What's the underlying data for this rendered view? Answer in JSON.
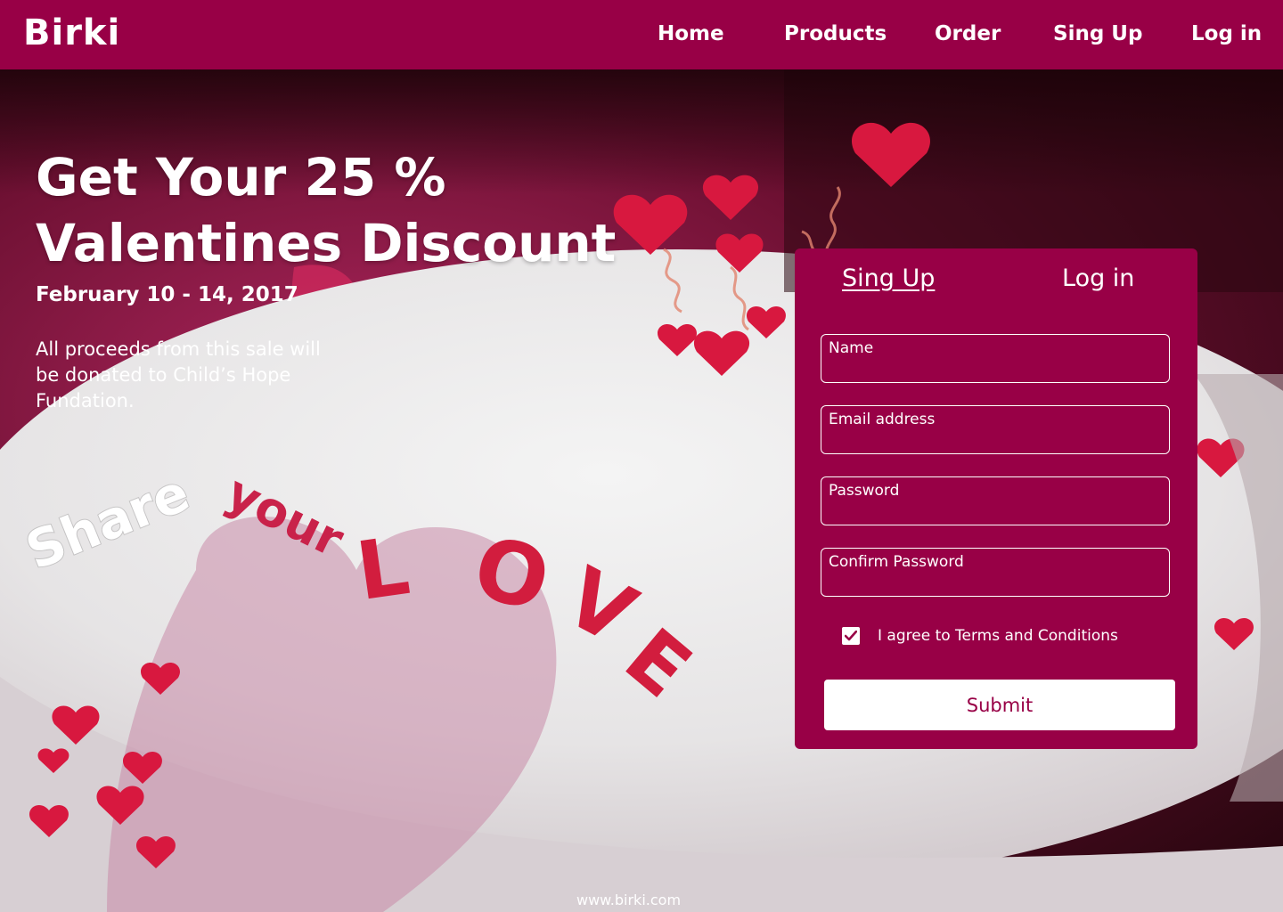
{
  "brand": "Birki",
  "nav": {
    "home": "Home",
    "products": "Products",
    "order": "Order",
    "signup": "Sing Up",
    "login": "Log in"
  },
  "hero": {
    "headline_line1": "Get Your 25 %",
    "headline_line2": "Valentines Discount",
    "dates": "February 10 - 14, 2017",
    "proceeds": "All proceeds from this sale will be donated to Child’s Hope Fundation.",
    "tagline_word1": "Share",
    "tagline_word2": "your",
    "cake_word": "LOVE"
  },
  "form": {
    "tab_signup": "Sing Up",
    "tab_login": "Log in",
    "name_label": "Name",
    "email_label": "Email address",
    "password_label": "Password",
    "confirm_label": "Confirm Password",
    "agree_text": "I agree to Terms and Conditions",
    "agree_checked": true,
    "submit_label": "Submit"
  },
  "footer": {
    "url": "www.birki.com"
  },
  "colors": {
    "brand": "#980046",
    "text": "#ffffff",
    "icing": "#eeeeee",
    "hearts": "#d8183f"
  }
}
